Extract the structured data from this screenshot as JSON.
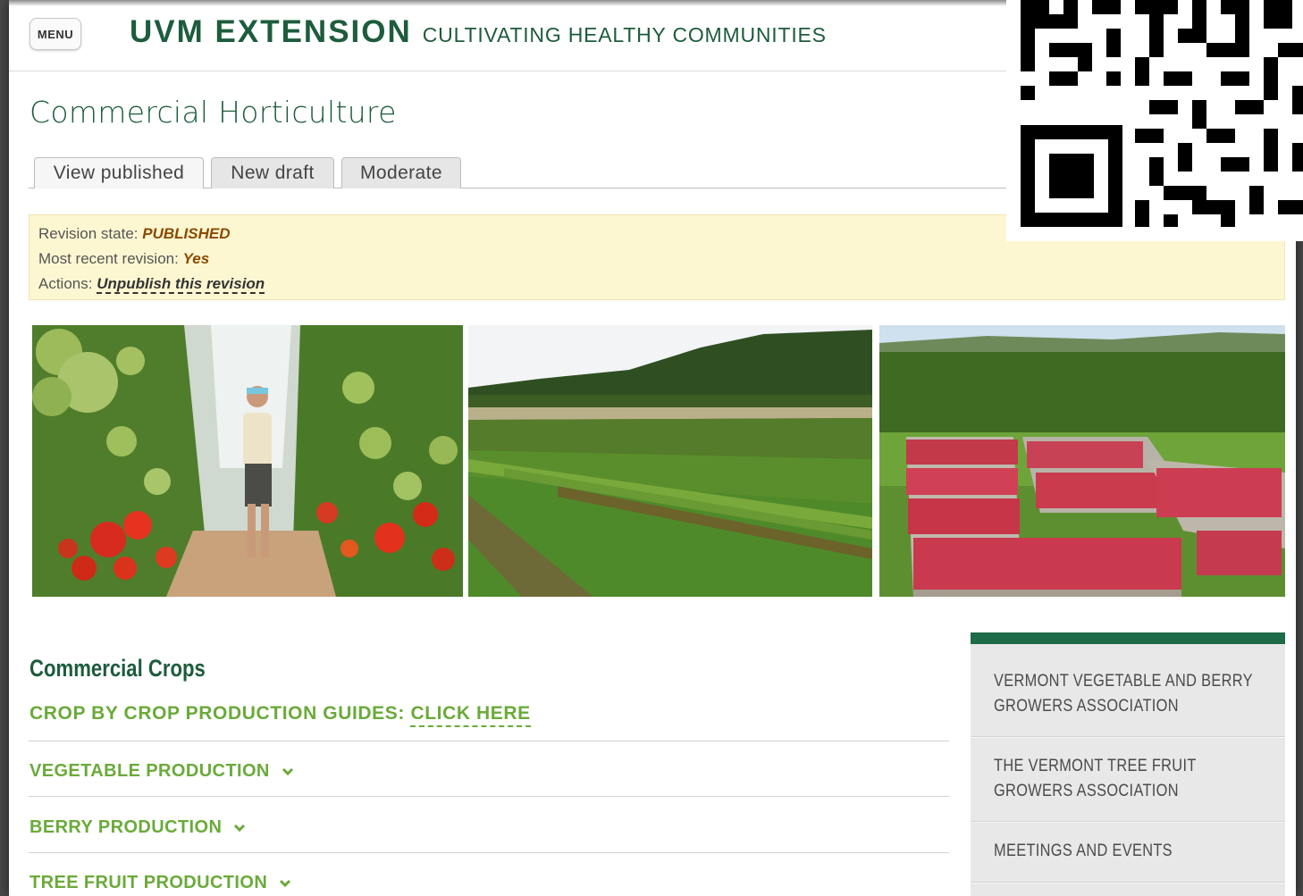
{
  "header": {
    "menu_label": "MENU",
    "brand_name": "UVM EXTENSION",
    "brand_tagline": "CULTIVATING HEALTHY COMMUNITIES"
  },
  "page_title": "Commercial Horticulture",
  "tabs": [
    {
      "label": "View published",
      "active": true
    },
    {
      "label": "New draft",
      "active": false
    },
    {
      "label": "Moderate",
      "active": false
    }
  ],
  "revision": {
    "state_label": "Revision state:",
    "state_value": "PUBLISHED",
    "recent_label": "Most recent revision:",
    "recent_value": "Yes",
    "actions_label": "Actions:",
    "actions_link": "Unpublish this revision"
  },
  "photos": [
    {
      "subject": "greenhouse tomatoes with grower"
    },
    {
      "subject": "vegetable field rows"
    },
    {
      "subject": "crates of red apples in orchard"
    }
  ],
  "content": {
    "section_title": "Commercial Crops",
    "guide_prefix": "CROP BY CROP PRODUCTION GUIDES:",
    "guide_link": "CLICK HERE",
    "accordions": [
      {
        "label": "VEGETABLE PRODUCTION"
      },
      {
        "label": "BERRY PRODUCTION"
      },
      {
        "label": "TREE FRUIT PRODUCTION"
      }
    ]
  },
  "sidebar": {
    "items": [
      {
        "label": "VERMONT VEGETABLE AND BERRY GROWERS ASSOCIATION"
      },
      {
        "label": "THE VERMONT TREE FRUIT GROWERS ASSOCIATION"
      },
      {
        "label": "MEETINGS AND EVENTS"
      }
    ]
  },
  "colors": {
    "brand_green": "#1d5c3c",
    "link_green": "#6aaa3a",
    "sidebar_accent": "#1d6b47",
    "revision_bg": "#fdf7d1"
  },
  "icons": {
    "accordion_chevron": "chevron-down-icon",
    "qr": "qr-code-icon"
  }
}
